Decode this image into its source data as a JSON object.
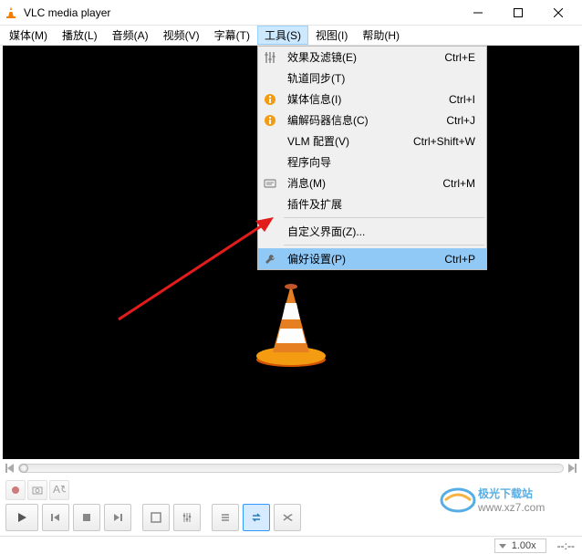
{
  "title": "VLC media player",
  "menubar": {
    "items": [
      "媒体(M)",
      "播放(L)",
      "音频(A)",
      "视频(V)",
      "字幕(T)",
      "工具(S)",
      "视图(I)",
      "帮助(H)"
    ],
    "active_index": 5
  },
  "dropdown": {
    "items": [
      {
        "icon": "sliders",
        "label": "效果及滤镜(E)",
        "shortcut": "Ctrl+E"
      },
      {
        "icon": "",
        "label": "轨道同步(T)",
        "shortcut": ""
      },
      {
        "icon": "info",
        "label": "媒体信息(I)",
        "shortcut": "Ctrl+I"
      },
      {
        "icon": "info",
        "label": "编解码器信息(C)",
        "shortcut": "Ctrl+J"
      },
      {
        "icon": "",
        "label": "VLM 配置(V)",
        "shortcut": "Ctrl+Shift+W"
      },
      {
        "icon": "",
        "label": "程序向导",
        "shortcut": ""
      },
      {
        "icon": "messages",
        "label": "消息(M)",
        "shortcut": "Ctrl+M"
      },
      {
        "icon": "",
        "label": "插件及扩展",
        "shortcut": ""
      },
      {
        "type": "separator"
      },
      {
        "icon": "",
        "label": "自定义界面(Z)...",
        "shortcut": ""
      },
      {
        "type": "separator"
      },
      {
        "icon": "wrench",
        "label": "偏好设置(P)",
        "shortcut": "Ctrl+P",
        "highlight": true
      }
    ]
  },
  "status": {
    "speed": "1.00x",
    "time": "--:--"
  },
  "watermark": {
    "line1": "极光下载站",
    "line2": "www.xz7.com"
  }
}
